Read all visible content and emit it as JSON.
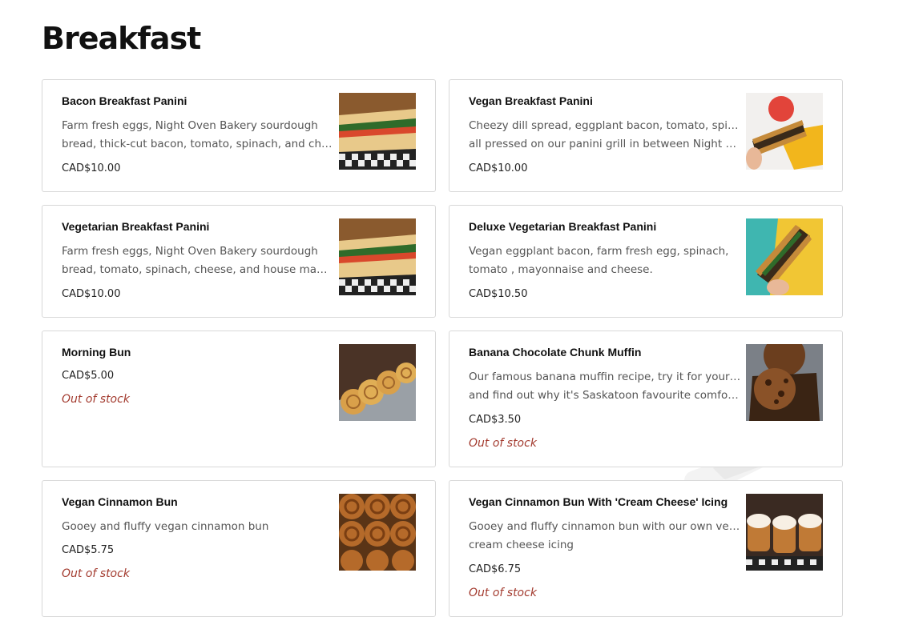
{
  "page": {
    "title": "Breakfast",
    "watermark": "sirved"
  },
  "items": [
    {
      "name": "Bacon Breakfast Panini",
      "desc": [
        "Farm fresh eggs, Night Oven Bakery sourdough",
        "bread, thick-cut bacon, tomato, spinach, and cheese."
      ],
      "price": "CAD$10.00",
      "status": "",
      "image": "panini-photo"
    },
    {
      "name": "Vegan Breakfast Panini",
      "desc": [
        "Cheezy dill spread, eggplant bacon, tomato, spinach",
        "all pressed on our panini grill in between Night Ove..."
      ],
      "price": "CAD$10.00",
      "status": "",
      "image": "vegan-panini-photo"
    },
    {
      "name": "Vegetarian Breakfast Panini",
      "desc": [
        "Farm fresh eggs, Night Oven Bakery sourdough",
        "bread, tomato, spinach, cheese, and house made..."
      ],
      "price": "CAD$10.00",
      "status": "",
      "image": "panini-photo"
    },
    {
      "name": "Deluxe Vegetarian Breakfast Panini",
      "desc": [
        "Vegan eggplant bacon, farm fresh egg, spinach,",
        "tomato , mayonnaise and cheese."
      ],
      "price": "CAD$10.50",
      "status": "",
      "image": "deluxe-panini-photo"
    },
    {
      "name": "Morning Bun",
      "desc": [],
      "price": "CAD$5.00",
      "status": "Out of stock",
      "image": "morning-bun-photo"
    },
    {
      "name": "Banana Chocolate Chunk Muffin",
      "desc": [
        "Our famous banana muffin recipe, try it for yourself",
        "and find out why it's Saskatoon favourite comfort..."
      ],
      "price": "CAD$3.50",
      "status": "Out of stock",
      "image": "muffin-photo"
    },
    {
      "name": "Vegan Cinnamon Bun",
      "desc": [
        "Gooey and fluffy vegan cinnamon bun"
      ],
      "price": "CAD$5.75",
      "status": "Out of stock",
      "image": "cinnamon-bun-photo"
    },
    {
      "name": "Vegan Cinnamon Bun With 'Cream Cheese' Icing",
      "desc": [
        "Gooey and fluffy cinnamon bun with our own vegan",
        "cream cheese icing"
      ],
      "price": "CAD$6.75",
      "status": "Out of stock",
      "image": "iced-cinnamon-bun-photo"
    }
  ],
  "colors": {
    "out_of_stock": "#a33b2f",
    "border": "#d8d8d8"
  }
}
